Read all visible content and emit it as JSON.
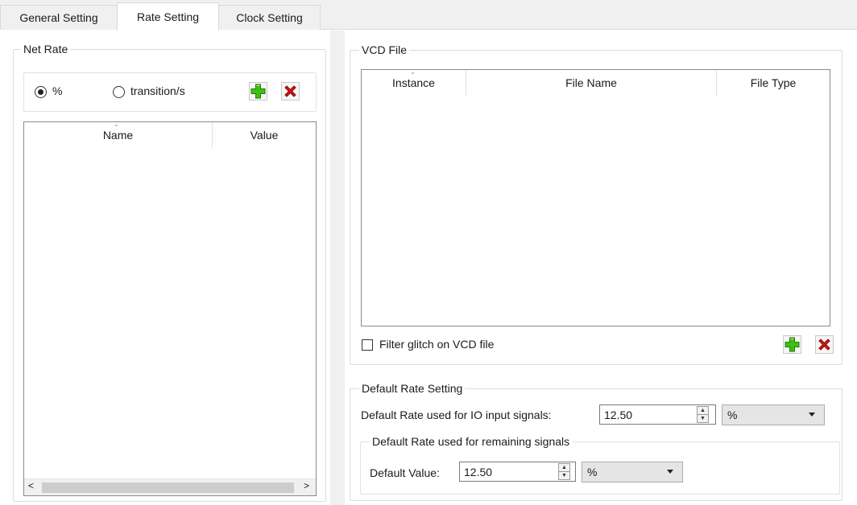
{
  "tabs": [
    "General Setting",
    "Rate Setting",
    "Clock Setting"
  ],
  "net_rate": {
    "title": "Net Rate",
    "radio_percent": "%",
    "radio_transition": "transition/s",
    "columns": [
      "Name",
      "Value"
    ],
    "scroll_left": "<",
    "scroll_right": ">"
  },
  "vcd_file": {
    "title": "VCD File",
    "columns": [
      "Instance",
      "File Name",
      "File Type"
    ],
    "filter_label": "Filter glitch on VCD file"
  },
  "default_rate": {
    "title": "Default Rate Setting",
    "io_label": "Default Rate used for IO input signals:",
    "io_value": "12.50",
    "io_unit": "%",
    "remaining_title": "Default Rate used for remaining signals",
    "default_value_label": "Default Value:",
    "default_value": "12.50",
    "default_unit": "%"
  },
  "icons": {
    "add": "plus-icon",
    "delete": "x-icon"
  },
  "colors": {
    "add_green": "#38b000",
    "delete_red": "#d61414"
  }
}
